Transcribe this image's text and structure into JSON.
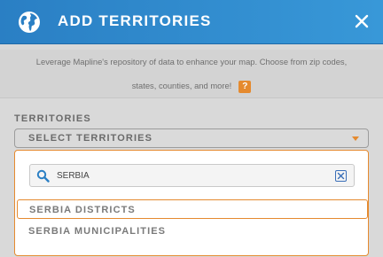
{
  "header": {
    "title": "ADD TERRITORIES",
    "bg_color": "#2a7fc4",
    "icon": "globe-icon",
    "close_icon": "close-icon"
  },
  "description": {
    "line1": "Leverage Mapline's repository of data to enhance your map. Choose from zip codes,",
    "line2": "states, counties, and more!",
    "help_label": "?"
  },
  "territories": {
    "section_label": "TERRITORIES",
    "select_label": "SELECT TERRITORIES",
    "accent_color": "#e58a2f"
  },
  "search": {
    "value": "SERBIA",
    "placeholder": "",
    "icon": "search-icon",
    "clear_icon": "clear-search-icon"
  },
  "results": [
    {
      "label": "SERBIA DISTRICTS",
      "highlighted": true
    },
    {
      "label": "SERBIA MUNICIPALITIES",
      "highlighted": false
    }
  ]
}
